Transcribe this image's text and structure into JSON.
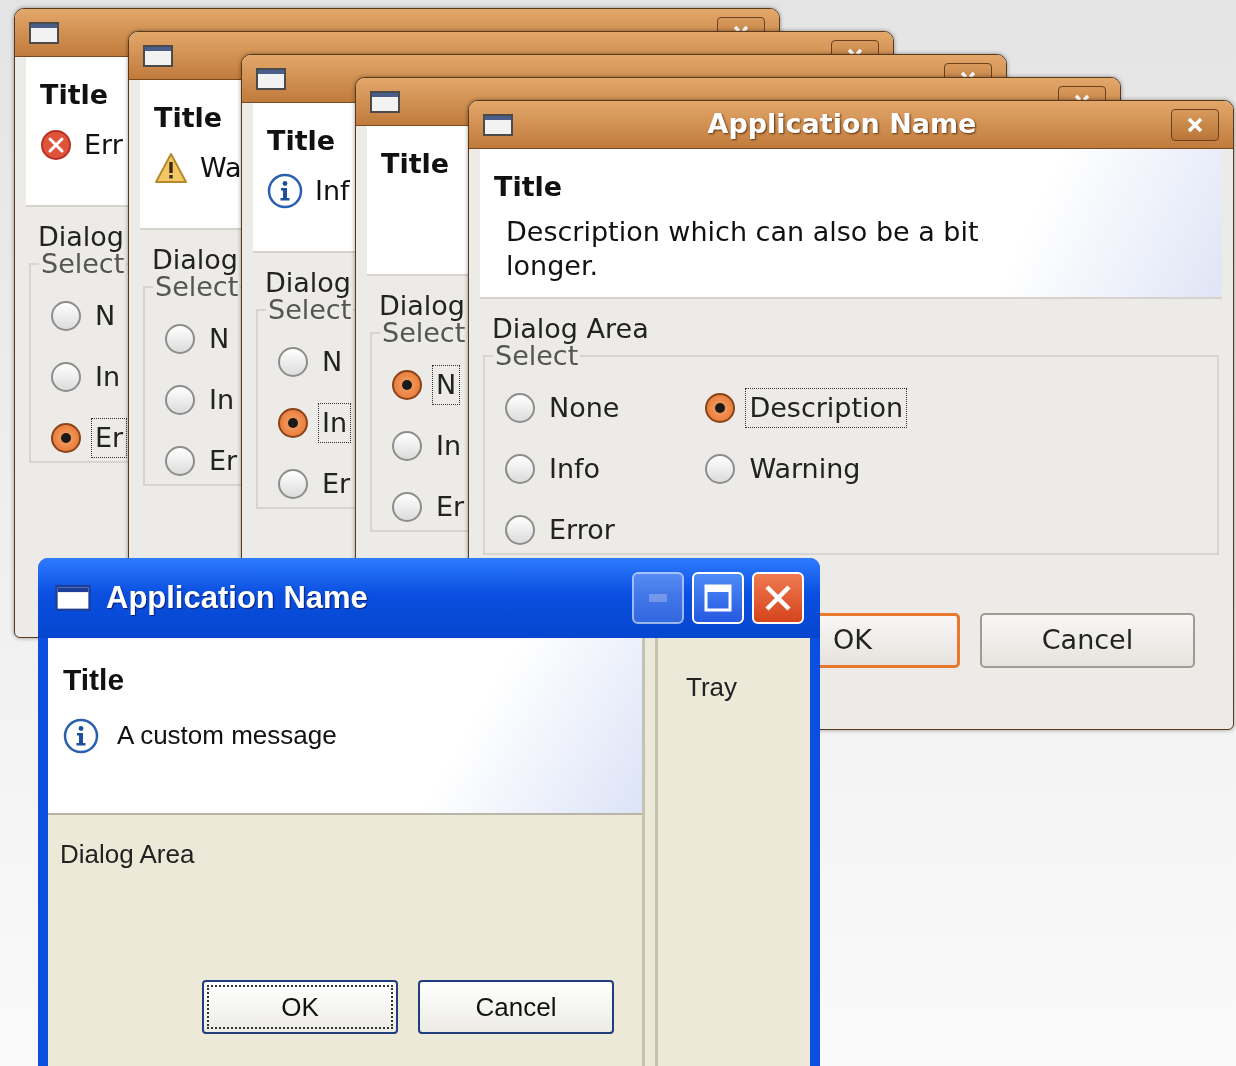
{
  "dialogs": [
    {
      "heading": "Title",
      "message": {
        "kind": "error",
        "text": "Err"
      },
      "area_label": "Dialog",
      "group_label": "Select",
      "options": [
        {
          "label": "N",
          "selected": false
        },
        {
          "label": "In",
          "selected": false
        },
        {
          "label": "Er",
          "selected": true
        }
      ]
    },
    {
      "heading": "Title",
      "message": {
        "kind": "warning",
        "text": "Wa"
      },
      "area_label": "Dialog",
      "group_label": "Select",
      "options": [
        {
          "label": "N",
          "selected": false
        },
        {
          "label": "In",
          "selected": false
        },
        {
          "label": "Er",
          "selected": false
        }
      ]
    },
    {
      "heading": "Title",
      "message": {
        "kind": "info",
        "text": "Inf"
      },
      "area_label": "Dialog",
      "group_label": "Select",
      "options": [
        {
          "label": "N",
          "selected": false
        },
        {
          "label": "In",
          "selected": true
        },
        {
          "label": "Er",
          "selected": false
        }
      ]
    },
    {
      "heading": "Title",
      "area_label": "Dialog",
      "group_label": "Select",
      "options": [
        {
          "label": "N",
          "selected": true
        },
        {
          "label": "In",
          "selected": false
        },
        {
          "label": "Er",
          "selected": false
        }
      ]
    },
    {
      "title": "Application Name",
      "heading": "Title",
      "message": {
        "kind": "description",
        "text": "Description which can also be a bit longer."
      },
      "area_label": "Dialog Area",
      "group_label": "Select",
      "options": [
        {
          "label": "None",
          "selected": false
        },
        {
          "label": "Info",
          "selected": false
        },
        {
          "label": "Error",
          "selected": false
        },
        {
          "label": "Description",
          "selected": true
        },
        {
          "label": "Warning",
          "selected": false
        }
      ],
      "buttons": [
        {
          "label": "OK",
          "default": true
        },
        {
          "label": "Cancel",
          "default": false
        }
      ]
    }
  ],
  "xp_dialog": {
    "title": "Application Name",
    "title_buttons": [
      {
        "kind": "minimize",
        "disabled": true
      },
      {
        "kind": "maximize",
        "disabled": false
      },
      {
        "kind": "close",
        "disabled": false
      }
    ],
    "heading": "Title",
    "message": {
      "kind": "info",
      "text": "A custom message"
    },
    "area_label": "Dialog Area",
    "tray": "Tray",
    "buttons": [
      {
        "label": "OK",
        "default": true
      },
      {
        "label": "Cancel",
        "default": false
      }
    ]
  }
}
